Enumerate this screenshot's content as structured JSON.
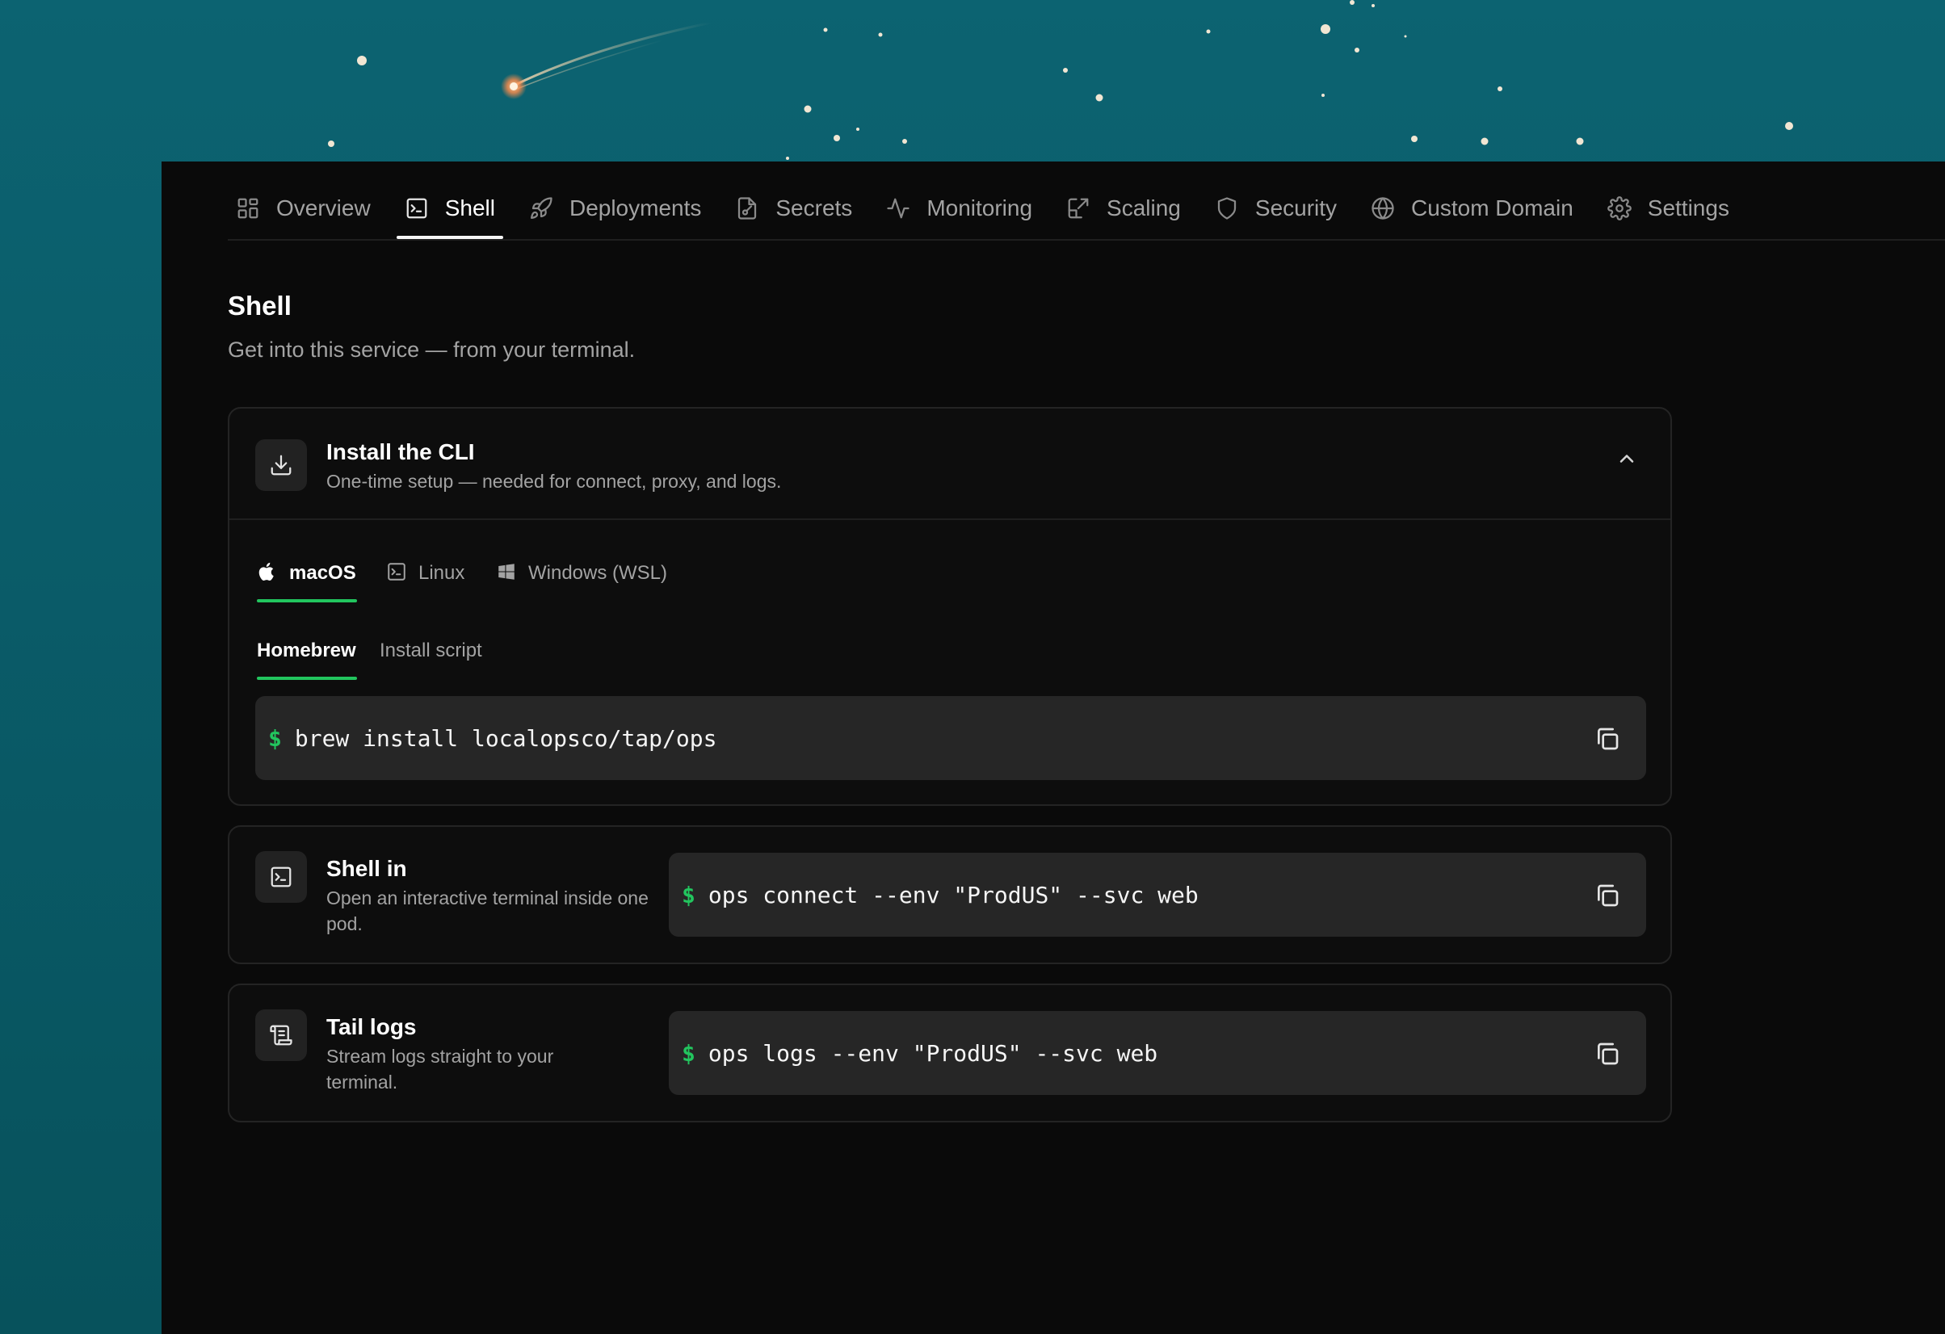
{
  "tabs": [
    {
      "label": "Overview",
      "icon": "grid-icon"
    },
    {
      "label": "Shell",
      "icon": "terminal-icon",
      "active": true
    },
    {
      "label": "Deployments",
      "icon": "rocket-icon"
    },
    {
      "label": "Secrets",
      "icon": "file-key-icon"
    },
    {
      "label": "Monitoring",
      "icon": "activity-icon"
    },
    {
      "label": "Scaling",
      "icon": "scale-icon"
    },
    {
      "label": "Security",
      "icon": "shield-icon"
    },
    {
      "label": "Custom Domain",
      "icon": "globe-icon"
    },
    {
      "label": "Settings",
      "icon": "gear-icon"
    }
  ],
  "page": {
    "title": "Shell",
    "subtitle": "Get into this service — from your terminal."
  },
  "install": {
    "title": "Install the CLI",
    "description": "One-time setup — needed for connect, proxy, and logs.",
    "expanded": true,
    "os_tabs": [
      {
        "label": "macOS",
        "icon": "apple-icon",
        "active": true
      },
      {
        "label": "Linux",
        "icon": "terminal-icon"
      },
      {
        "label": "Windows (WSL)",
        "icon": "windows-icon"
      }
    ],
    "method_tabs": [
      {
        "label": "Homebrew",
        "active": true
      },
      {
        "label": "Install script"
      }
    ],
    "prompt": "$",
    "command": "brew install localopsco/tap/ops"
  },
  "shell_in": {
    "title": "Shell in",
    "description": "Open an interactive terminal inside one pod.",
    "prompt": "$",
    "command": "ops connect --env \"ProdUS\" --svc web"
  },
  "tail_logs": {
    "title": "Tail logs",
    "description": "Stream logs straight to your terminal.",
    "prompt": "$",
    "command": "ops logs --env \"ProdUS\" --svc web"
  },
  "colors": {
    "accent": "#22c55e",
    "panel": "#0a0a0a",
    "background": "#0a5f6c",
    "code_bg": "#262626"
  }
}
